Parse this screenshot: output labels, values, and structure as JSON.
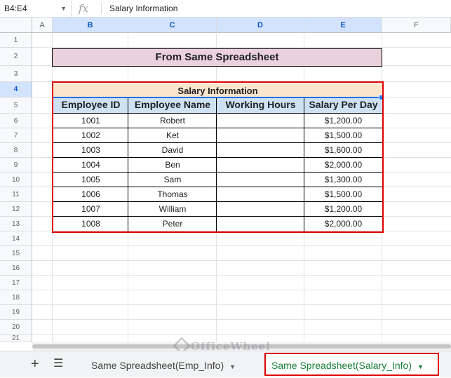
{
  "formula_bar": {
    "cell_ref": "B4:E4",
    "fx_label": "fx",
    "value": "Salary Information"
  },
  "columns": [
    "A",
    "B",
    "C",
    "D",
    "E",
    "F"
  ],
  "rows": [
    "1",
    "2",
    "3",
    "4",
    "5",
    "6",
    "7",
    "8",
    "9",
    "10",
    "11",
    "12",
    "13",
    "14",
    "15",
    "16",
    "17",
    "18",
    "19",
    "20",
    "21"
  ],
  "sheet": {
    "title": "From Same Spreadsheet",
    "table_title": "Salary Information",
    "headers": [
      "Employee ID",
      "Employee Name",
      "Working Hours",
      "Salary Per Day"
    ],
    "records": [
      [
        "1001",
        "Robert",
        "",
        "$1,200.00"
      ],
      [
        "1002",
        "Ket",
        "",
        "$1,500.00"
      ],
      [
        "1003",
        "David",
        "",
        "$1,600.00"
      ],
      [
        "1004",
        "Ben",
        "",
        "$2,000.00"
      ],
      [
        "1005",
        "Sam",
        "",
        "$1,300.00"
      ],
      [
        "1006",
        "Thomas",
        "",
        "$1,500.00"
      ],
      [
        "1007",
        "William",
        "",
        "$1,200.00"
      ],
      [
        "1008",
        "Peter",
        "",
        "$2,000.00"
      ]
    ]
  },
  "tabs": [
    {
      "label": "Same Spreadsheet(Emp_Info)",
      "active": false
    },
    {
      "label": "Same Spreadsheet(Salary_Info)",
      "active": true
    }
  ],
  "watermark": "OfficeWheel",
  "colors": {
    "accent": "#1a73e8",
    "highlight": "#e00000",
    "active_tab": "#188038"
  }
}
